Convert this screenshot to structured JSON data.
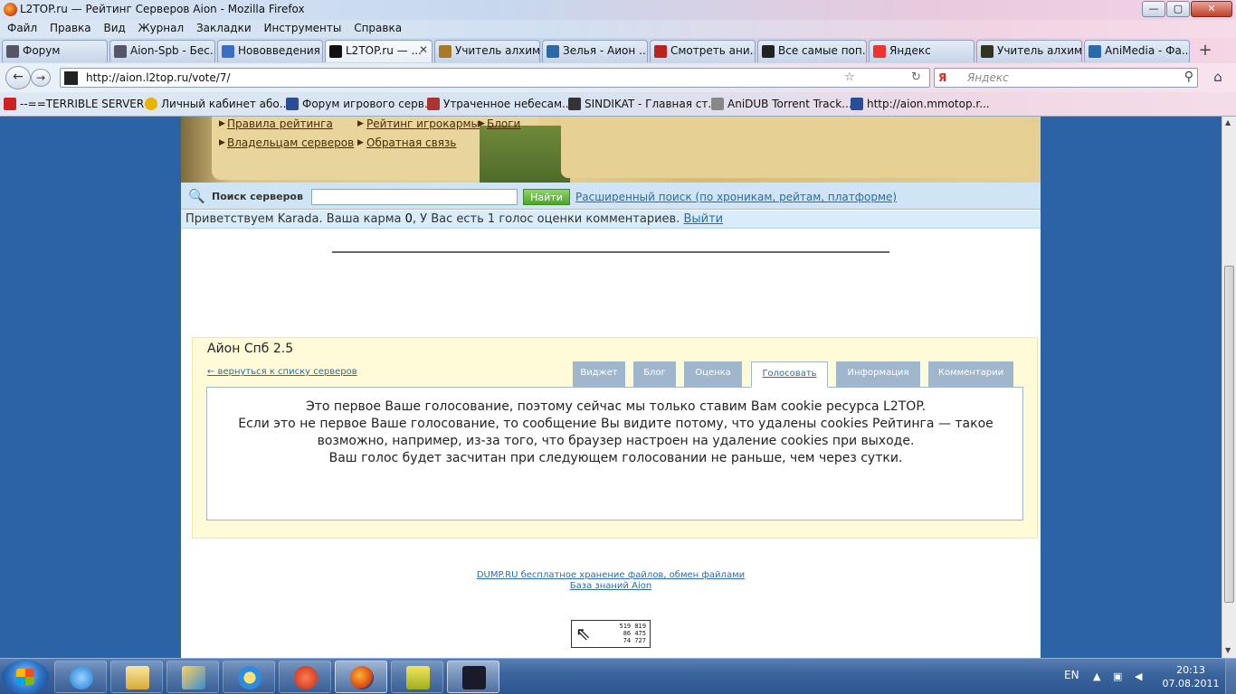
{
  "window": {
    "title": "L2TOP.ru — Рейтинг Серверов Aion - Mozilla Firefox",
    "controls": {
      "minimize": "—",
      "maximize": "▢",
      "close": "✕"
    }
  },
  "menu": [
    "Файл",
    "Правка",
    "Вид",
    "Журнал",
    "Закладки",
    "Инструменты",
    "Справка"
  ],
  "tabs": [
    {
      "label": "Форум",
      "icon": "forum-icon"
    },
    {
      "label": "Aion-Spb - Бес...",
      "icon": "spb-icon"
    },
    {
      "label": "Нововведения ...",
      "icon": "news-icon"
    },
    {
      "label": "L2TOP.ru — ...",
      "icon": "l2top-icon",
      "active": true
    },
    {
      "label": "Учитель алхим...",
      "icon": "aion-icon"
    },
    {
      "label": "Зелья - Аион ...",
      "icon": "aion-a-icon"
    },
    {
      "label": "Смотреть ани...",
      "icon": "anime-icon"
    },
    {
      "label": "Все самые поп...",
      "icon": "film-icon"
    },
    {
      "label": "Яндекс",
      "icon": "yandex-icon"
    },
    {
      "label": "Учитель алхим...",
      "icon": "alchemy-icon"
    },
    {
      "label": "AniMedia - Фа...",
      "icon": "animedia-icon"
    }
  ],
  "tab_close": "✕",
  "new_tab": "+",
  "nav": {
    "back": "←",
    "forward": "→",
    "url": "http://aion.l2top.ru/vote/7/",
    "search_engine": "Я",
    "search_placeholder": "Яндекс",
    "search_go": "⚲",
    "home": "⌂",
    "star": "☆",
    "reload": "↻"
  },
  "bookmarks": [
    "--==TERRIBLE SERVER ...",
    "Личный кабинет або...",
    "Форум игрового серв...",
    "Утраченное небесам...",
    "SINDIKAT - Главная ст...",
    "AniDUB Torrent Track...",
    "http://aion.mmotop.r..."
  ],
  "site": {
    "banner_links": {
      "rules": "Правила рейтинга",
      "owners": "Владельцам серверов",
      "karma": "Рейтинг игрокармы",
      "blogs": "Блоги",
      "feedback": "Обратная связь"
    },
    "search": {
      "label": "Поиск серверов",
      "button": "Найти",
      "advanced": "Расширенный поиск (по хроникам, рейтам, платформе)"
    },
    "greeting": {
      "text_before": "Приветствуем Karada. Ваша карма ",
      "karma": "0",
      "text_after": ", У Вас есть 1 голос оценки комментариев. ",
      "logout": "Выйти"
    },
    "server": {
      "name": "Айон Спб 2.5",
      "back_link": "← вернуться к списку серверов",
      "tabs": [
        "Виджет",
        "Блог",
        "Оценка",
        "Голосовать",
        "Информация",
        "Комментарии"
      ],
      "active_tab": "Голосовать",
      "message": [
        "Это первое Ваше голосование, поэтому сейчас мы только ставим Вам cookie ресурса L2TOP.",
        "Если это не первое Ваше голосование, то сообщение Вы видите потому, что удалены cookies Рейтинга — такое",
        "возможно, например, из-за того, что браузер настроен на удаление cookies при выходе.",
        "Ваш голос будет засчитан при следующем голосовании не раньше, чем через сутки."
      ]
    },
    "footer_links": [
      "DUMP.RU бесплатное хранение файлов, обмен файлами",
      "База знаний Aion"
    ],
    "counter": [
      "519 819",
      "86 475",
      "74 727"
    ]
  },
  "taskbar": {
    "apps": [
      "start-button",
      "internet-explorer-icon",
      "explorer-icon",
      "paint-icon",
      "media-player-icon",
      "ccleaner-icon",
      "firefox-icon",
      "game-icon",
      "aion-app-icon"
    ],
    "lang": "EN",
    "time": "20:13",
    "date": "07.08.2011"
  }
}
